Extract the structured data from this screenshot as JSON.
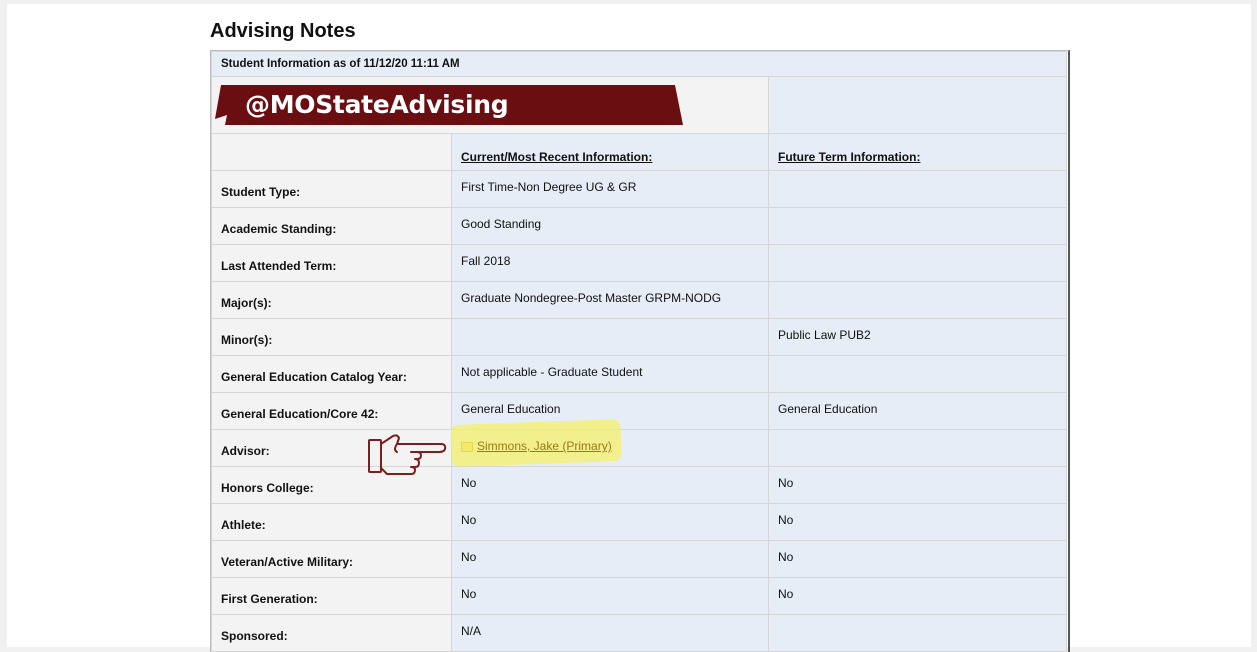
{
  "page": {
    "title": "Advising Notes"
  },
  "table": {
    "info_caption": "Student Information as of 11/12/20 11:11 AM",
    "banner_text": "@MOStateAdvising",
    "headers": {
      "current": "Current/Most Recent Information:",
      "future": "Future Term Information:"
    },
    "rows": [
      {
        "label": "Student Type:",
        "current": "First Time-Non Degree UG & GR",
        "future": ""
      },
      {
        "label": "Academic Standing:",
        "current": "Good Standing",
        "future": ""
      },
      {
        "label": "Last Attended Term:",
        "current": "Fall 2018",
        "future": ""
      },
      {
        "label": "Major(s):",
        "current": "Graduate Nondegree-Post Master GRPM-NODG",
        "future": ""
      },
      {
        "label": "Minor(s):",
        "current": "",
        "future": "Public Law PUB2"
      },
      {
        "label": "General Education Catalog Year:",
        "current": "Not applicable - Graduate Student",
        "future": ""
      },
      {
        "label": "General Education/Core 42:",
        "current": "General Education",
        "future": "General Education"
      },
      {
        "label": "Advisor:",
        "current": "Simmons, Jake  (Primary)",
        "future": ""
      },
      {
        "label": "Honors College:",
        "current": "No",
        "future": "No"
      },
      {
        "label": "Athlete:",
        "current": "No",
        "future": "No"
      },
      {
        "label": "Veteran/Active Military:",
        "current": "No",
        "future": "No"
      },
      {
        "label": "First Generation:",
        "current": "No",
        "future": "No"
      },
      {
        "label": "Sponsored:",
        "current": "N/A",
        "future": ""
      }
    ]
  },
  "colors": {
    "banner": "#6b0e12",
    "cell_blue": "#e6edf7",
    "label_gray": "#f3f3f3",
    "highlight": "#f6ef6a",
    "hand_outline": "#7a1e1e"
  },
  "icons": {
    "pointer": "pointing-hand-icon",
    "advisor": "contact-card-icon"
  }
}
